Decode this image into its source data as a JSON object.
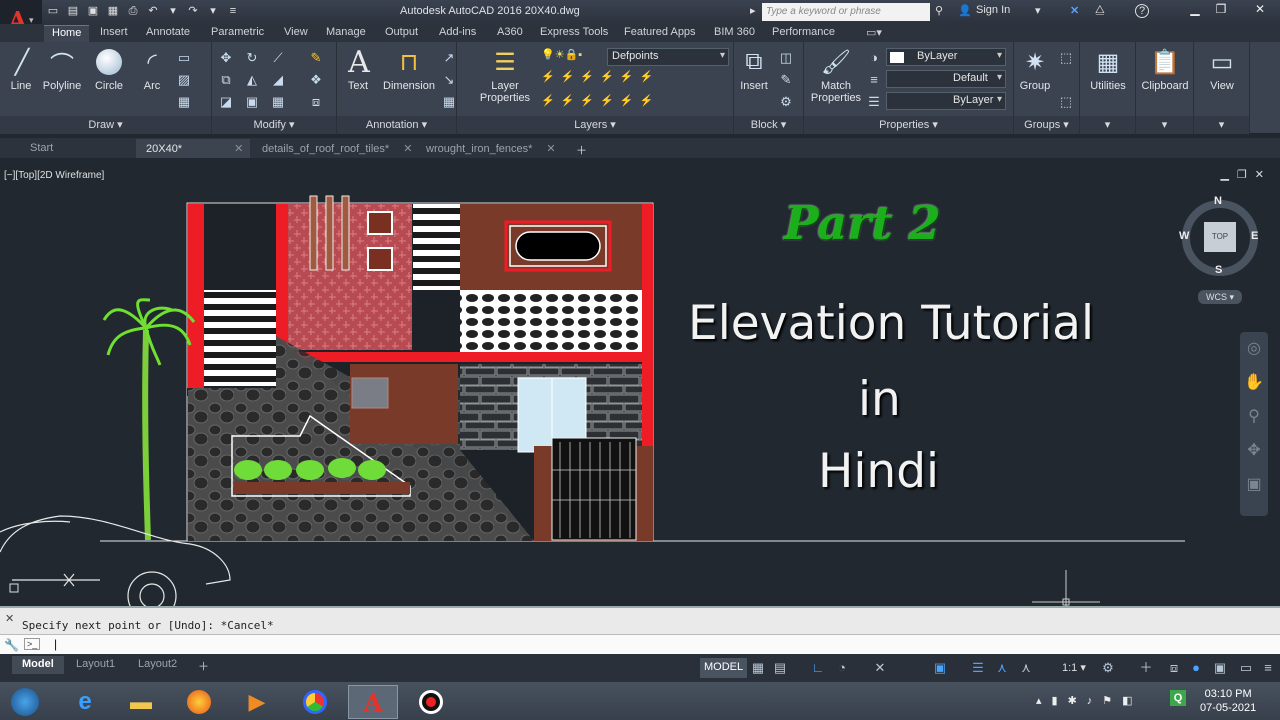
{
  "window": {
    "title": "Autodesk AutoCAD 2016    20X40.dwg",
    "search_placeholder": "Type a keyword or phrase",
    "sign_in": "Sign In",
    "help": "?"
  },
  "ribbon_tabs": [
    "Home",
    "Insert",
    "Annotate",
    "Parametric",
    "View",
    "Manage",
    "Output",
    "Add-ins",
    "A360",
    "Express Tools",
    "Featured Apps",
    "BIM 360",
    "Performance"
  ],
  "ribbon": {
    "draw": {
      "title": "Draw",
      "line": "Line",
      "polyline": "Polyline",
      "circle": "Circle",
      "arc": "Arc"
    },
    "modify": {
      "title": "Modify"
    },
    "annotation": {
      "title": "Annotation",
      "text": "Text",
      "dimension": "Dimension"
    },
    "layers": {
      "title": "Layers",
      "layer_properties_1": "Layer",
      "layer_properties_2": "Properties",
      "current_layer": "Defpoints"
    },
    "block": {
      "title": "Block",
      "insert": "Insert"
    },
    "properties": {
      "title": "Properties",
      "match_1": "Match",
      "match_2": "Properties",
      "color": "ByLayer",
      "linetype": "Default",
      "lineweight": "ByLayer"
    },
    "groups": {
      "title": "Groups",
      "group": "Group"
    },
    "utilities": "Utilities",
    "clipboard": "Clipboard",
    "view": "View"
  },
  "file_tabs": [
    {
      "label": "Start",
      "active": false
    },
    {
      "label": "20X40*",
      "active": true
    },
    {
      "label": "details_of_roof_roof_tiles*",
      "active": false
    },
    {
      "label": "wrought_iron_fences*",
      "active": false
    }
  ],
  "viewport": {
    "label": "[−][Top][2D Wireframe]",
    "overlay_part": "Part 2",
    "overlay_line1": "Elevation Tutorial",
    "overlay_line2": "in",
    "overlay_line3": "Hindi",
    "viewcube": {
      "n": "N",
      "s": "S",
      "e": "E",
      "w": "W",
      "top": "TOP",
      "wcs": "WCS"
    }
  },
  "command": {
    "history": "Specify next point or [Undo]: *Cancel*",
    "prompt_icon": ">_"
  },
  "layout_tabs": [
    {
      "label": "Model",
      "active": true
    },
    {
      "label": "Layout1",
      "active": false
    },
    {
      "label": "Layout2",
      "active": false
    }
  ],
  "status": {
    "model": "MODEL",
    "scale": "1:1"
  },
  "taskbar": {
    "time": "03:10 PM",
    "date": "07-05-2021"
  }
}
